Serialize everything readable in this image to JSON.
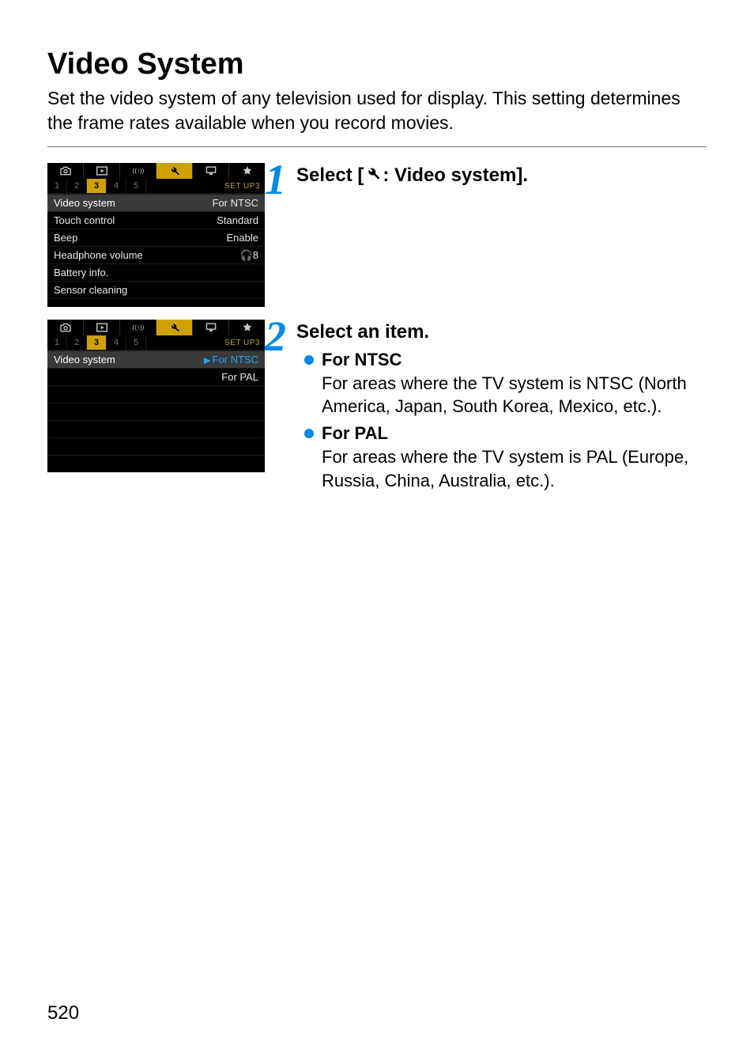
{
  "page": {
    "title": "Video System",
    "intro": "Set the video system of any television used for display. This setting determines the frame rates available when you record movies.",
    "number": "520"
  },
  "steps": [
    {
      "num": "1",
      "headline_prefix": "Select [",
      "headline_icon": "wrench",
      "headline_suffix": ": Video system]."
    },
    {
      "num": "2",
      "headline": "Select an item.",
      "bullets": [
        {
          "head": "For NTSC",
          "desc": "For areas where the TV system is NTSC (North America, Japan, South Korea, Mexico, etc.)."
        },
        {
          "head": "For PAL",
          "desc": "For areas where the TV system is PAL (Europe, Russia, China, Australia, etc.)."
        }
      ]
    }
  ],
  "cam_common": {
    "tabs": [
      "camera",
      "play",
      "wifi",
      "wrench",
      "display",
      "star"
    ],
    "active_tab_index": 3,
    "subtabs": [
      "1",
      "2",
      "3",
      "4",
      "5"
    ],
    "active_subtab_index": 2,
    "subtab_label": "SET UP3"
  },
  "cam1": {
    "rows": [
      {
        "label": "Video system",
        "value": "For NTSC",
        "selected": true
      },
      {
        "label": "Touch control",
        "value": "Standard"
      },
      {
        "label": "Beep",
        "value": "Enable"
      },
      {
        "label": "Headphone volume",
        "value": "🎧8"
      },
      {
        "label": "Battery info.",
        "value": ""
      },
      {
        "label": "Sensor cleaning",
        "value": ""
      }
    ]
  },
  "cam2": {
    "rows": [
      {
        "label": "Video system",
        "value": "For NTSC",
        "selected": true,
        "value_blue": true,
        "caret": true
      },
      {
        "label": "",
        "value": "For PAL",
        "value_only": true
      }
    ],
    "empty_rows": 5
  }
}
